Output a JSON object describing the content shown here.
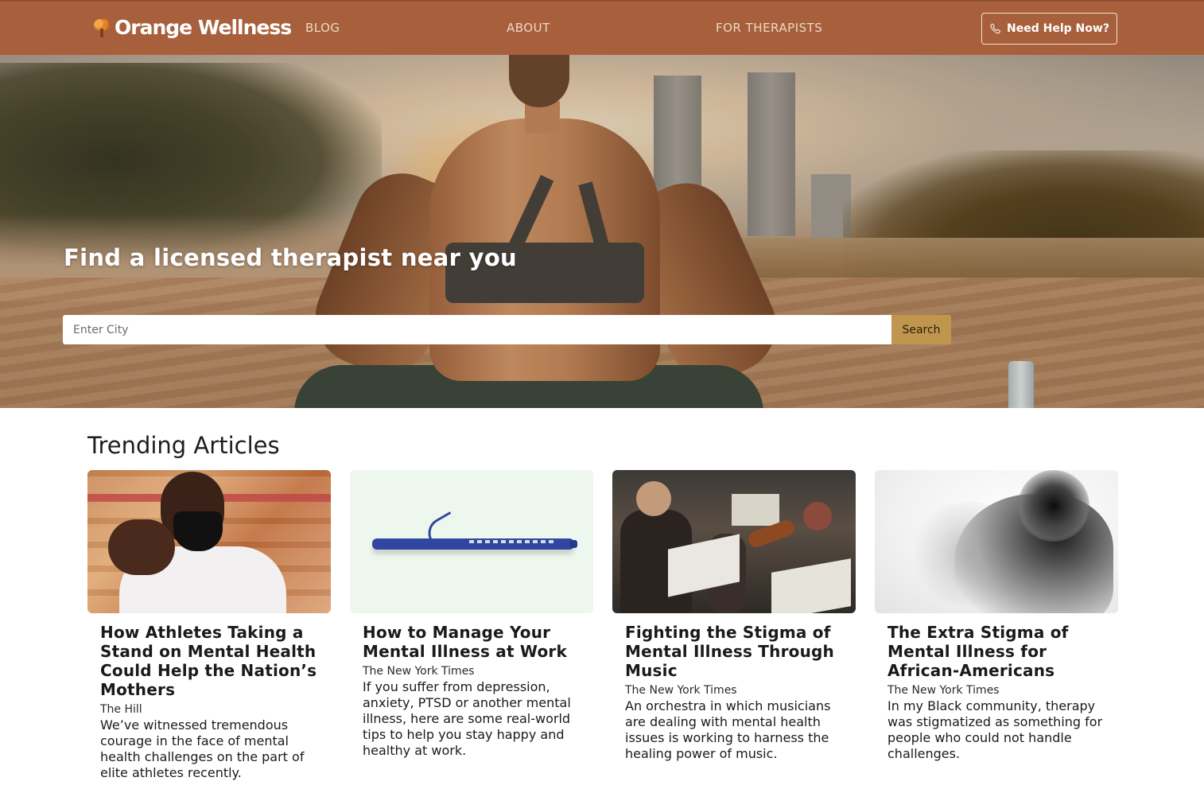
{
  "header": {
    "logo_text": "Orange Wellness",
    "nav": [
      {
        "label": "BLOG"
      },
      {
        "label": "ABOUT"
      },
      {
        "label": "FOR THERAPISTS"
      }
    ],
    "help_button_label": "Need Help Now?",
    "help_icon": "phone-icon"
  },
  "hero": {
    "title": "Find a licensed therapist near you",
    "search": {
      "placeholder": "Enter City",
      "value": "",
      "button_label": "Search"
    }
  },
  "trending": {
    "title": "Trending Articles",
    "articles": [
      {
        "title": "How Athletes Taking a Stand on Mental Health Could Help the Nation’s Mothers",
        "source": "The Hill",
        "description": "We’ve witnessed tremendous courage in the face of mental health challenges on the part of elite athletes recently."
      },
      {
        "title": "How to Manage Your Mental Illness at Work",
        "source": "The New York Times",
        "description": "If you suffer from depression, anxiety, PTSD or another mental illness, here are some real-world tips to help you stay happy and healthy at work."
      },
      {
        "title": "Fighting the Stigma of Mental Illness Through Music",
        "source": "The New York Times",
        "description": "An orchestra in which musicians are dealing with mental health issues is working to harness the healing power of music."
      },
      {
        "title": "The Extra Stigma of Mental Illness for African-Americans",
        "source": "The New York Times",
        "description": "In my Black community, therapy was stigmatized as something for people who could not handle challenges."
      }
    ]
  },
  "colors": {
    "navbar": "#a8603c",
    "search_button": "#c0964e",
    "text": "#1a1a1a"
  }
}
